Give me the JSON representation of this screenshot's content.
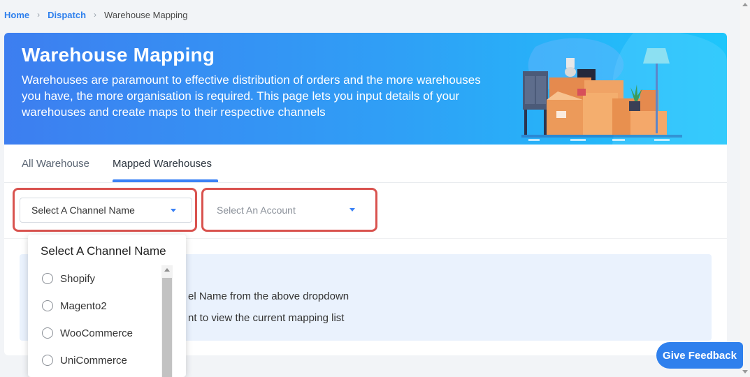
{
  "breadcrumb": {
    "home": "Home",
    "dispatch": "Dispatch",
    "current": "Warehouse Mapping"
  },
  "banner": {
    "title": "Warehouse Mapping",
    "description": "Warehouses are paramount to effective distribution of orders and the more warehouses you have, the more organisation is required. This page lets you input details of your warehouses and create maps to their respective channels"
  },
  "tabs": [
    {
      "label": "All Warehouse",
      "active": false
    },
    {
      "label": "Mapped Warehouses",
      "active": true
    }
  ],
  "filters": {
    "channel_placeholder": "Select A Channel Name",
    "account_placeholder": "Select An Account"
  },
  "info": {
    "line1_partial": "el Name from the above dropdown",
    "line2_partial": "nt to view the current mapping list"
  },
  "dropdown": {
    "title": "Select A Channel Name",
    "options": [
      "Shopify",
      "Magento2",
      "WooCommerce",
      "UniCommerce"
    ]
  },
  "feedback_label": "Give Feedback",
  "colors": {
    "accent": "#3b82f6",
    "highlight": "#d9534f",
    "banner_start": "#3d7ef0",
    "banner_end": "#1ec6fb"
  },
  "icons": {
    "breadcrumb_separator": "chevron-right-icon",
    "select_caret": "caret-down-icon"
  }
}
